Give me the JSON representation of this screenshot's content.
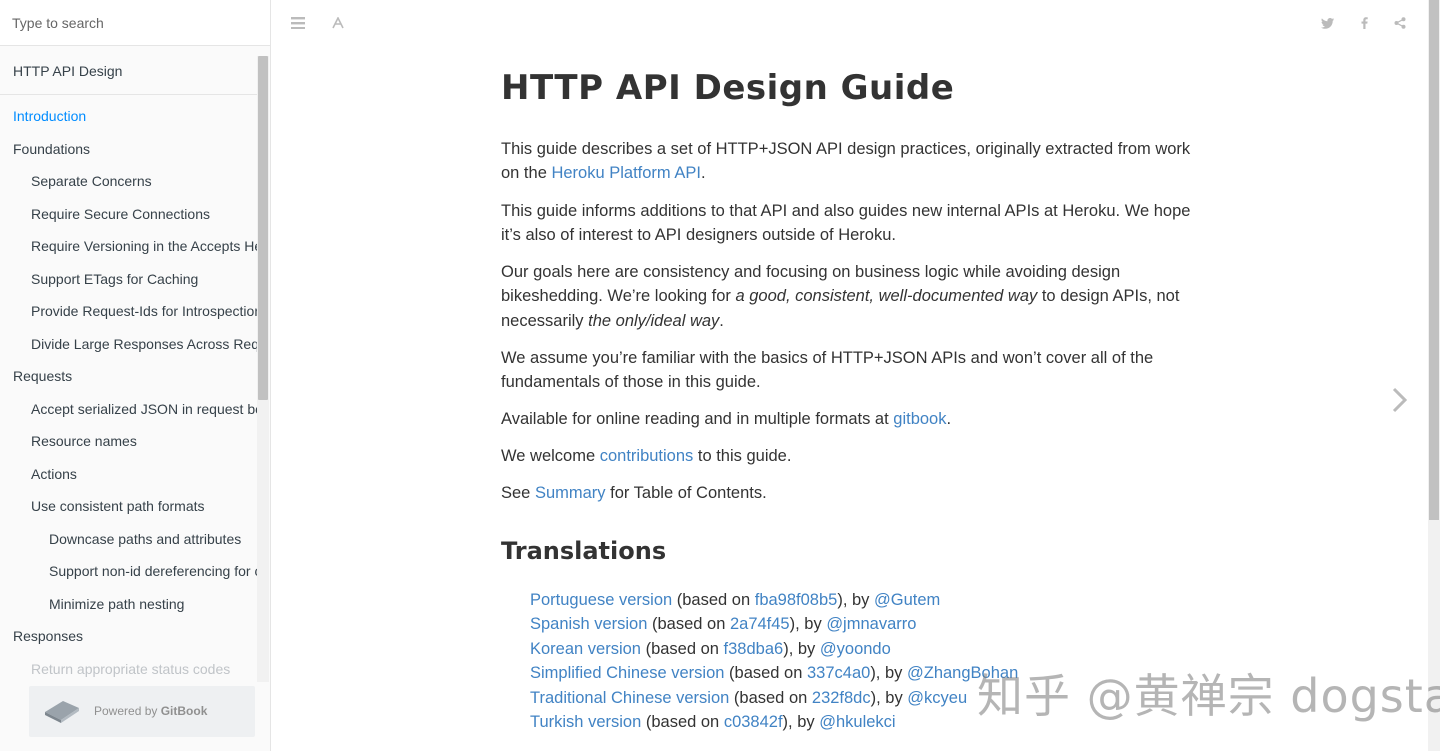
{
  "search": {
    "placeholder": "Type to search"
  },
  "sidebar": {
    "header": "HTTP API Design",
    "items": [
      {
        "label": "Introduction",
        "level": 0,
        "active": true
      },
      {
        "label": "Foundations",
        "level": 0
      },
      {
        "label": "Separate Concerns",
        "level": 1
      },
      {
        "label": "Require Secure Connections",
        "level": 1
      },
      {
        "label": "Require Versioning in the Accepts Header",
        "level": 1
      },
      {
        "label": "Support ETags for Caching",
        "level": 1
      },
      {
        "label": "Provide Request-Ids for Introspection",
        "level": 1
      },
      {
        "label": "Divide Large Responses Across Requests with Ranges",
        "level": 1
      },
      {
        "label": "Requests",
        "level": 0
      },
      {
        "label": "Accept serialized JSON in request bodies",
        "level": 1
      },
      {
        "label": "Resource names",
        "level": 1
      },
      {
        "label": "Actions",
        "level": 1
      },
      {
        "label": "Use consistent path formats",
        "level": 1
      },
      {
        "label": "Downcase paths and attributes",
        "level": 2
      },
      {
        "label": "Support non-id dereferencing for convenience",
        "level": 2
      },
      {
        "label": "Minimize path nesting",
        "level": 2
      },
      {
        "label": "Responses",
        "level": 0
      },
      {
        "label": "Return appropriate status codes",
        "level": 1,
        "faded": true
      }
    ],
    "powered_prefix": "Powered by",
    "powered_brand": "GitBook"
  },
  "toolbar": {
    "left_icons": [
      "menu-icon",
      "font-icon"
    ],
    "right_icons": [
      "twitter-icon",
      "facebook-icon",
      "share-icon"
    ]
  },
  "content": {
    "title": "HTTP API Design Guide",
    "p1_text": "This guide describes a set of HTTP+JSON API design practices, originally extracted from work on the ",
    "p1_link": "Heroku Platform API",
    "p1_end": ".",
    "p2": "This guide informs additions to that API and also guides new internal APIs at Heroku. We hope it’s also of interest to API designers outside of Heroku.",
    "p3_a": "Our goals here are consistency and focusing on business logic while avoiding design bikeshedding. We’re looking for ",
    "p3_em1": "a good, consistent, well-documented way",
    "p3_b": " to design APIs, not necessarily ",
    "p3_em2": "the only/ideal way",
    "p3_end": ".",
    "p4": "We assume you’re familiar with the basics of HTTP+JSON APIs and won’t cover all of the fundamentals of those in this guide.",
    "p5_a": "Available for online reading and in multiple formats at ",
    "p5_link": "gitbook",
    "p5_end": ".",
    "p6_a": "We welcome ",
    "p6_link": "contributions",
    "p6_b": " to this guide.",
    "p7_a": "See ",
    "p7_link": "Summary",
    "p7_b": " for Table of Contents.",
    "translations_title": "Translations",
    "based_on": " (based on ",
    "by": "), by ",
    "translations": [
      {
        "name": "Portuguese version",
        "commit": "fba98f08b5",
        "author": "@Gutem"
      },
      {
        "name": "Spanish version",
        "commit": "2a74f45",
        "author": "@jmnavarro"
      },
      {
        "name": "Korean version",
        "commit": "f38dba6",
        "author": "@yoondo"
      },
      {
        "name": "Simplified Chinese version",
        "commit": "337c4a0",
        "author": "@ZhangBohan"
      },
      {
        "name": "Traditional Chinese version",
        "commit": "232f8dc",
        "author": "@kcyeu"
      },
      {
        "name": "Turkish version",
        "commit": "c03842f",
        "author": "@hkulekci"
      }
    ]
  },
  "watermark": "知乎 @黄禅宗 dogstar",
  "colors": {
    "link": "#4183c4",
    "active": "#008cff",
    "text": "#333333",
    "sidebar_bg": "#fafafa"
  }
}
